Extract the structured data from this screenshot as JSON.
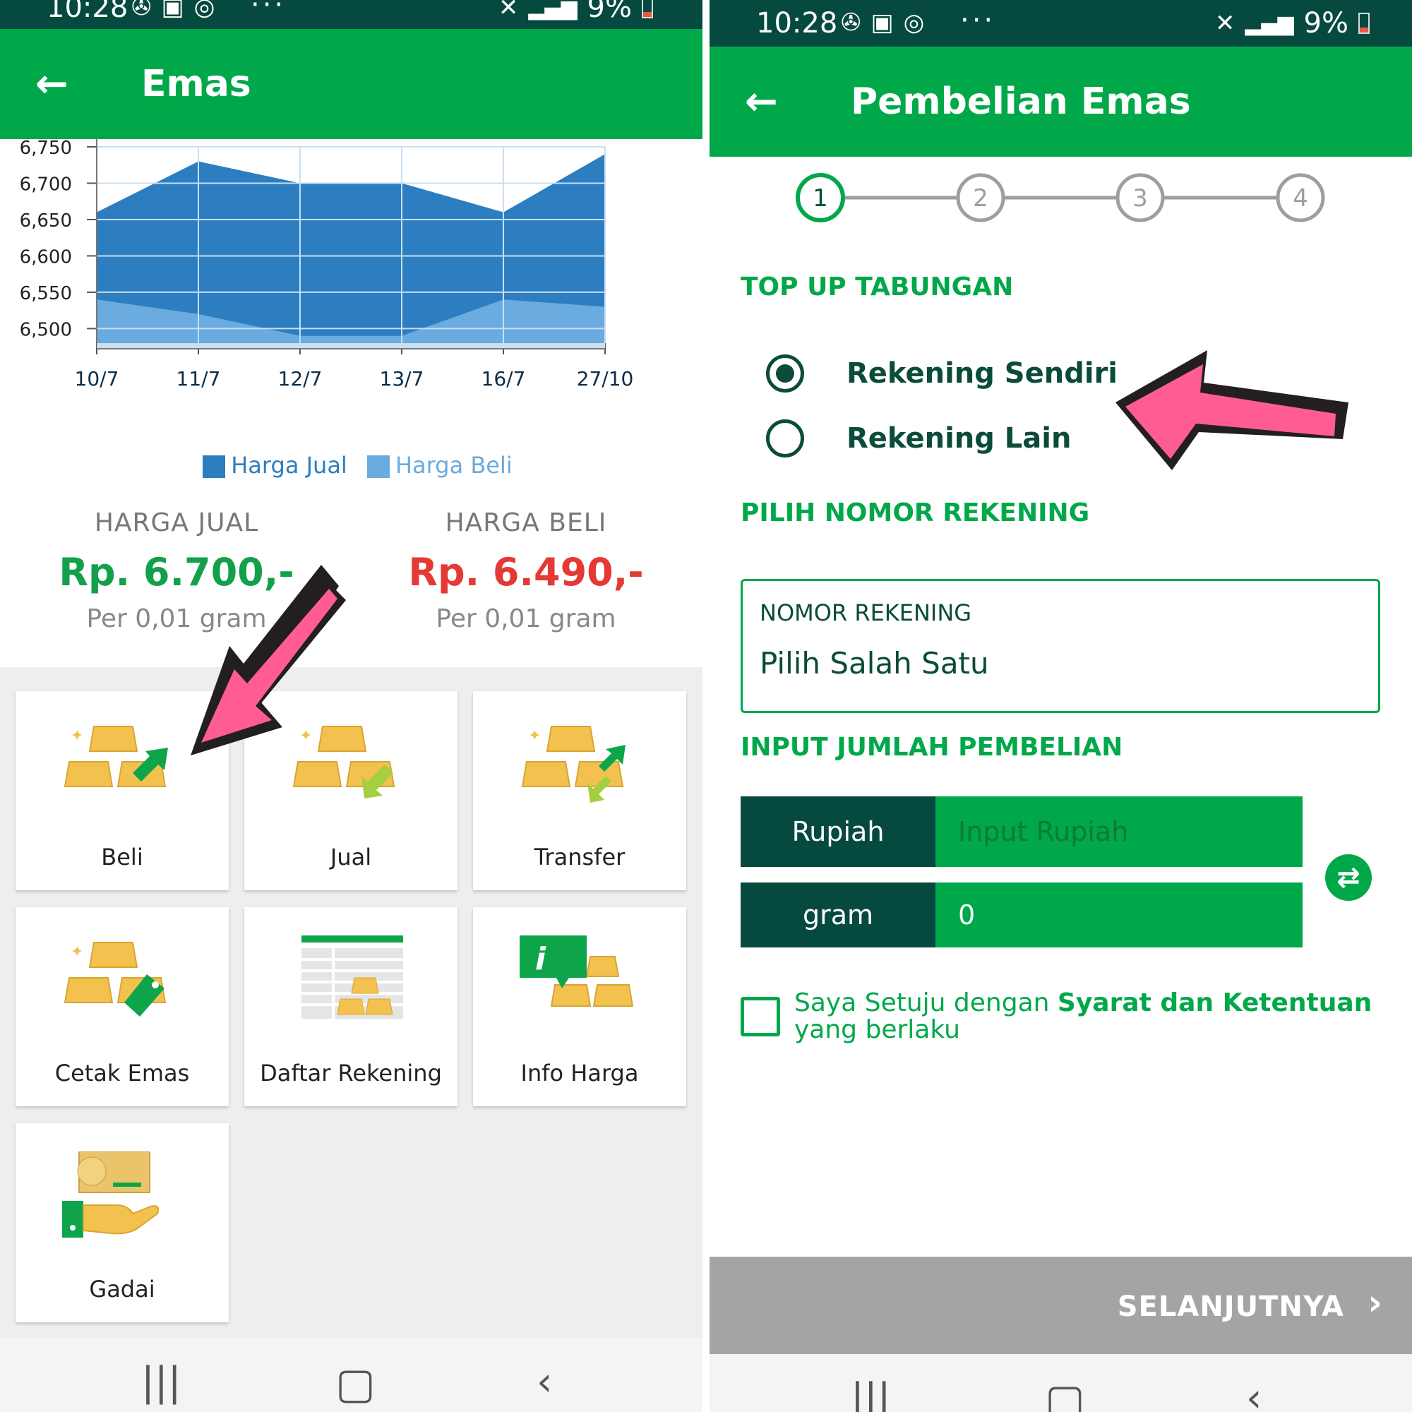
{
  "left": {
    "status": {
      "time": "10:28",
      "battery": "9%"
    },
    "appbar": {
      "title": "Emas"
    },
    "legend": {
      "jual": "Harga Jual",
      "beli": "Harga Beli"
    },
    "harga_jual": {
      "label": "HARGA JUAL",
      "value": "Rp. 6.700,-",
      "unit": "Per 0,01 gram"
    },
    "harga_beli": {
      "label": "HARGA BELI",
      "value": "Rp. 6.490,-",
      "unit": "Per 0,01 gram"
    },
    "menu": [
      "Beli",
      "Jual",
      "Transfer",
      "Cetak Emas",
      "Daftar Rekening",
      "Info Harga",
      "Gadai"
    ]
  },
  "right": {
    "status": {
      "time": "10:28",
      "battery": "9%"
    },
    "appbar": {
      "title": "Pembelian Emas"
    },
    "steps": [
      "1",
      "2",
      "3",
      "4"
    ],
    "section1": "TOP UP TABUNGAN",
    "radio1": "Rekening Sendiri",
    "radio2": "Rekening Lain",
    "section2": "PILIH NOMOR REKENING",
    "account_label": "NOMOR REKENING",
    "account_value": "Pilih Salah Satu",
    "section3": "INPUT JUMLAH PEMBELIAN",
    "rupiah_label": "Rupiah",
    "rupiah_placeholder": "Input Rupiah",
    "gram_label": "gram",
    "gram_value": "0",
    "agree_pre": "Saya Setuju dengan ",
    "agree_bold": "Syarat dan Ketentuan",
    "agree_post": " yang berlaku",
    "next": "SELANJUTNYA"
  },
  "colors": {
    "primary": "#00a84a",
    "dark": "#05493f",
    "jual_area": "#2c7ec0",
    "beli_area": "#6aabe0",
    "price_sell": "#13a04b",
    "price_buy": "#e53935",
    "arrow": "#ff5d92"
  },
  "chart_data": {
    "type": "area",
    "categories": [
      "10/7",
      "11/7",
      "12/7",
      "13/7",
      "16/7",
      "27/10"
    ],
    "series": [
      {
        "name": "Harga Jual",
        "values": [
          6660,
          6730,
          6700,
          6700,
          6660,
          6740
        ]
      },
      {
        "name": "Harga Beli",
        "values": [
          6540,
          6520,
          6490,
          6490,
          6540,
          6530
        ]
      }
    ],
    "ylim": [
      6480,
      6750
    ],
    "yticks": [
      "6,750",
      "6,700",
      "6,650",
      "6,600",
      "6,550",
      "6,500"
    ],
    "grid": true,
    "legend_position": "bottom"
  }
}
